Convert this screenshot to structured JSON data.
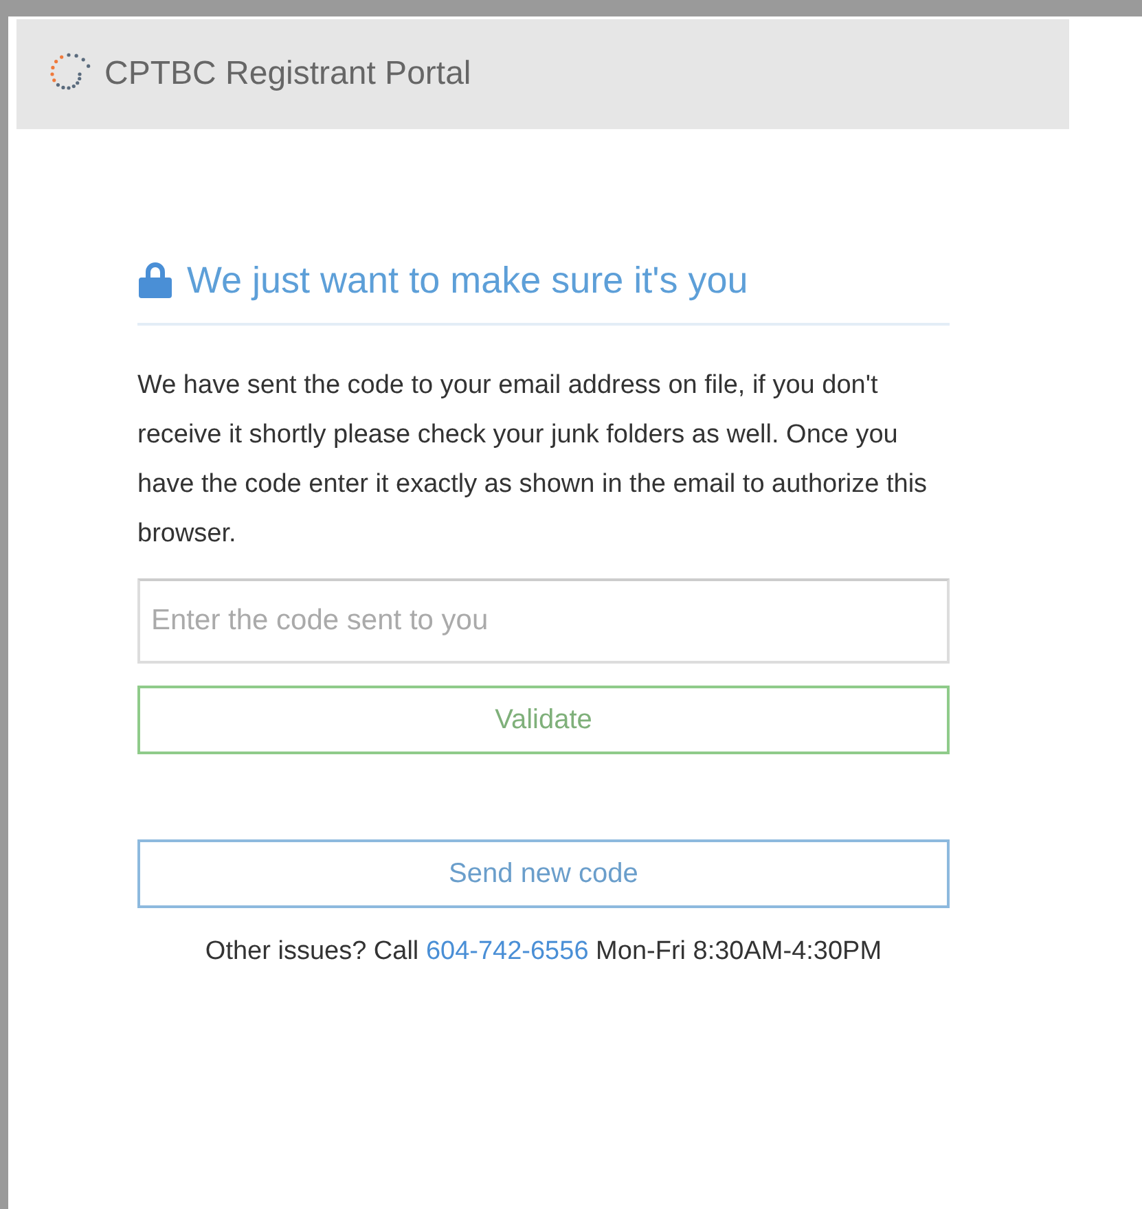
{
  "header": {
    "title": "CPTBC Registrant Portal"
  },
  "heading": "We just want to make sure it's you",
  "message": "We have sent the code to your email address on file, if you don't receive it shortly please check your junk folders as well. Once you have the code enter it exactly as shown in the email to authorize this browser.",
  "code_field": {
    "placeholder": "Enter the code sent to you"
  },
  "buttons": [
    {
      "label": "Validate",
      "kind": "validate"
    },
    {
      "label": "Send new code",
      "kind": "resend"
    }
  ],
  "footer": {
    "prefix": "Other issues? Call",
    "phone": "604-742-6556",
    "suffix": "Mon-Fri 8:30AM-4:30PM"
  }
}
